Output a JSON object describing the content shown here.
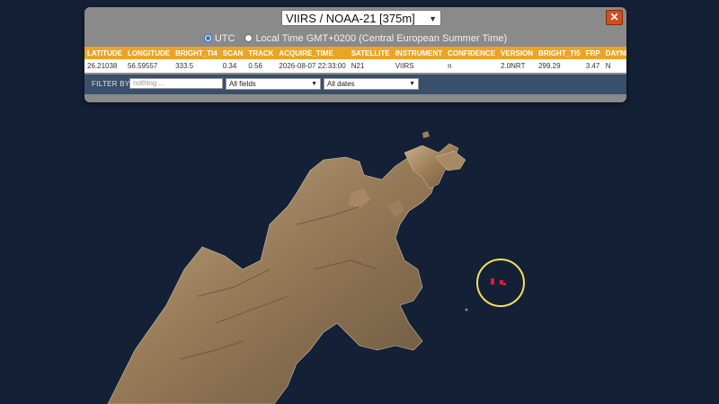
{
  "layer": {
    "selected": "VIIRS / NOAA-21 [375m]"
  },
  "close_label": "✕",
  "timezone": {
    "utc_label": "UTC",
    "local_label": "Local Time GMT+0200 (Central European Summer Time)",
    "selected": "UTC"
  },
  "table": {
    "headers": [
      "LATITUDE",
      "LONGITUDE",
      "BRIGHT_TI4",
      "SCAN",
      "TRACK",
      "ACQUIRE_TIME",
      "SATELLITE",
      "INSTRUMENT",
      "CONFIDENCE",
      "VERSION",
      "BRIGHT_TI5",
      "FRP",
      "DAYNIGHT"
    ],
    "rows": [
      [
        "26.21038",
        "56.59557",
        "333.5",
        "0.34",
        "0.56",
        "2026-08-07 22:33:00",
        "N21",
        "VIIRS",
        "n",
        "2.0NRT",
        "299.29",
        "3.47",
        "N"
      ]
    ]
  },
  "filter": {
    "label": "FILTER BY",
    "placeholder": "nothing ...",
    "fields_selected": "All fields",
    "dates_selected": "All dates"
  },
  "colors": {
    "header_bg": "#e8a526",
    "fire_marker": "#e3193b",
    "highlight_ring": "#f1e15a",
    "sea": "#142036"
  }
}
